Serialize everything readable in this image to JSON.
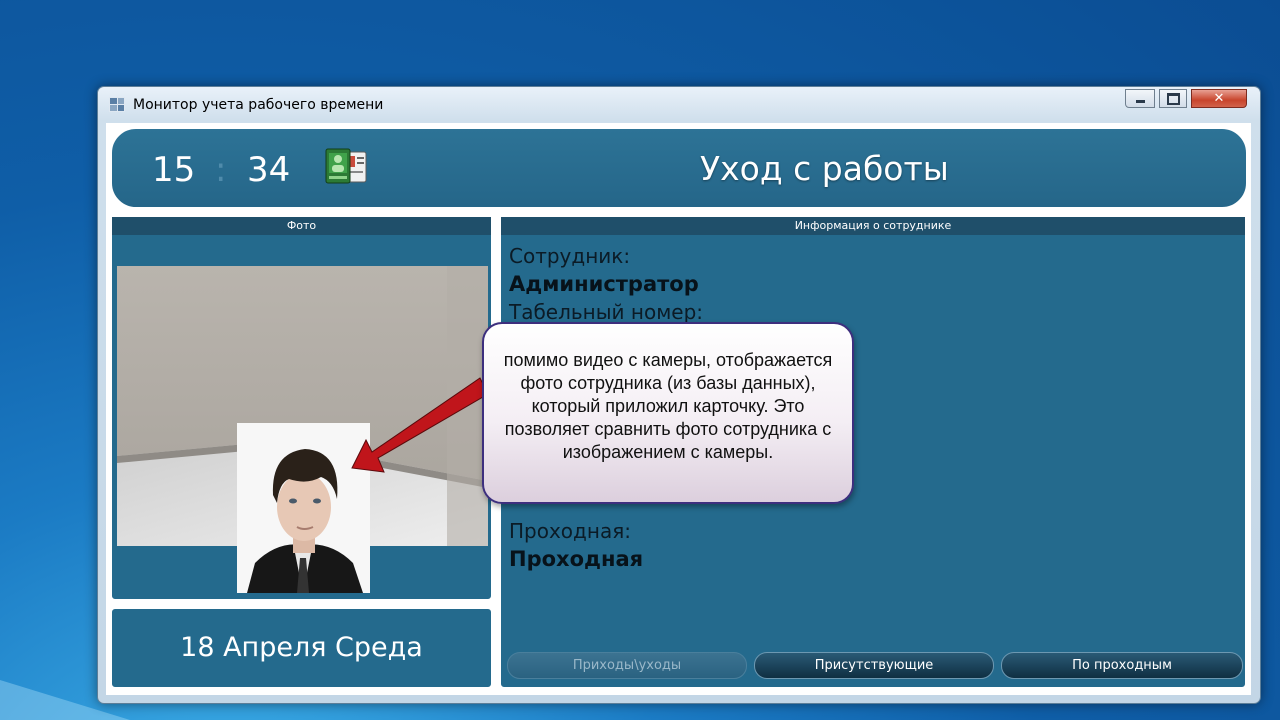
{
  "window": {
    "title": "Монитор учета рабочего времени",
    "close_glyph": "✕"
  },
  "header": {
    "hours": "15",
    "separator": ":",
    "minutes": "34",
    "event_title": "Уход с работы"
  },
  "photo_panel": {
    "caption": "Фото"
  },
  "date_panel": {
    "date_text": "18 Апреля Среда"
  },
  "info_panel": {
    "caption": "Информация о сотруднике",
    "employee_label": "Сотрудник:",
    "employee_value": "Администратор",
    "tab_number_label": "Табельный номер:",
    "checkpoint_label": "Проходная:",
    "checkpoint_value": "Проходная"
  },
  "buttons": {
    "arrivals_departures": "Приходы\\уходы",
    "present": "Присутствующие",
    "by_checkpoints": "По проходным"
  },
  "tooltip": {
    "text": "помимо видео с камеры, отображается фото сотрудника (из базы данных), который приложил карточку. Это позволяет сравнить фото сотрудника с изображением с камеры."
  },
  "colors": {
    "panel_bg": "#246a8d",
    "caption_bg": "#1f4f6a",
    "arrow_red": "#c0151b",
    "tooltip_border": "#3d2f7e"
  },
  "icons": {
    "app": "window-app-icon",
    "header": "employee-card-icon"
  }
}
